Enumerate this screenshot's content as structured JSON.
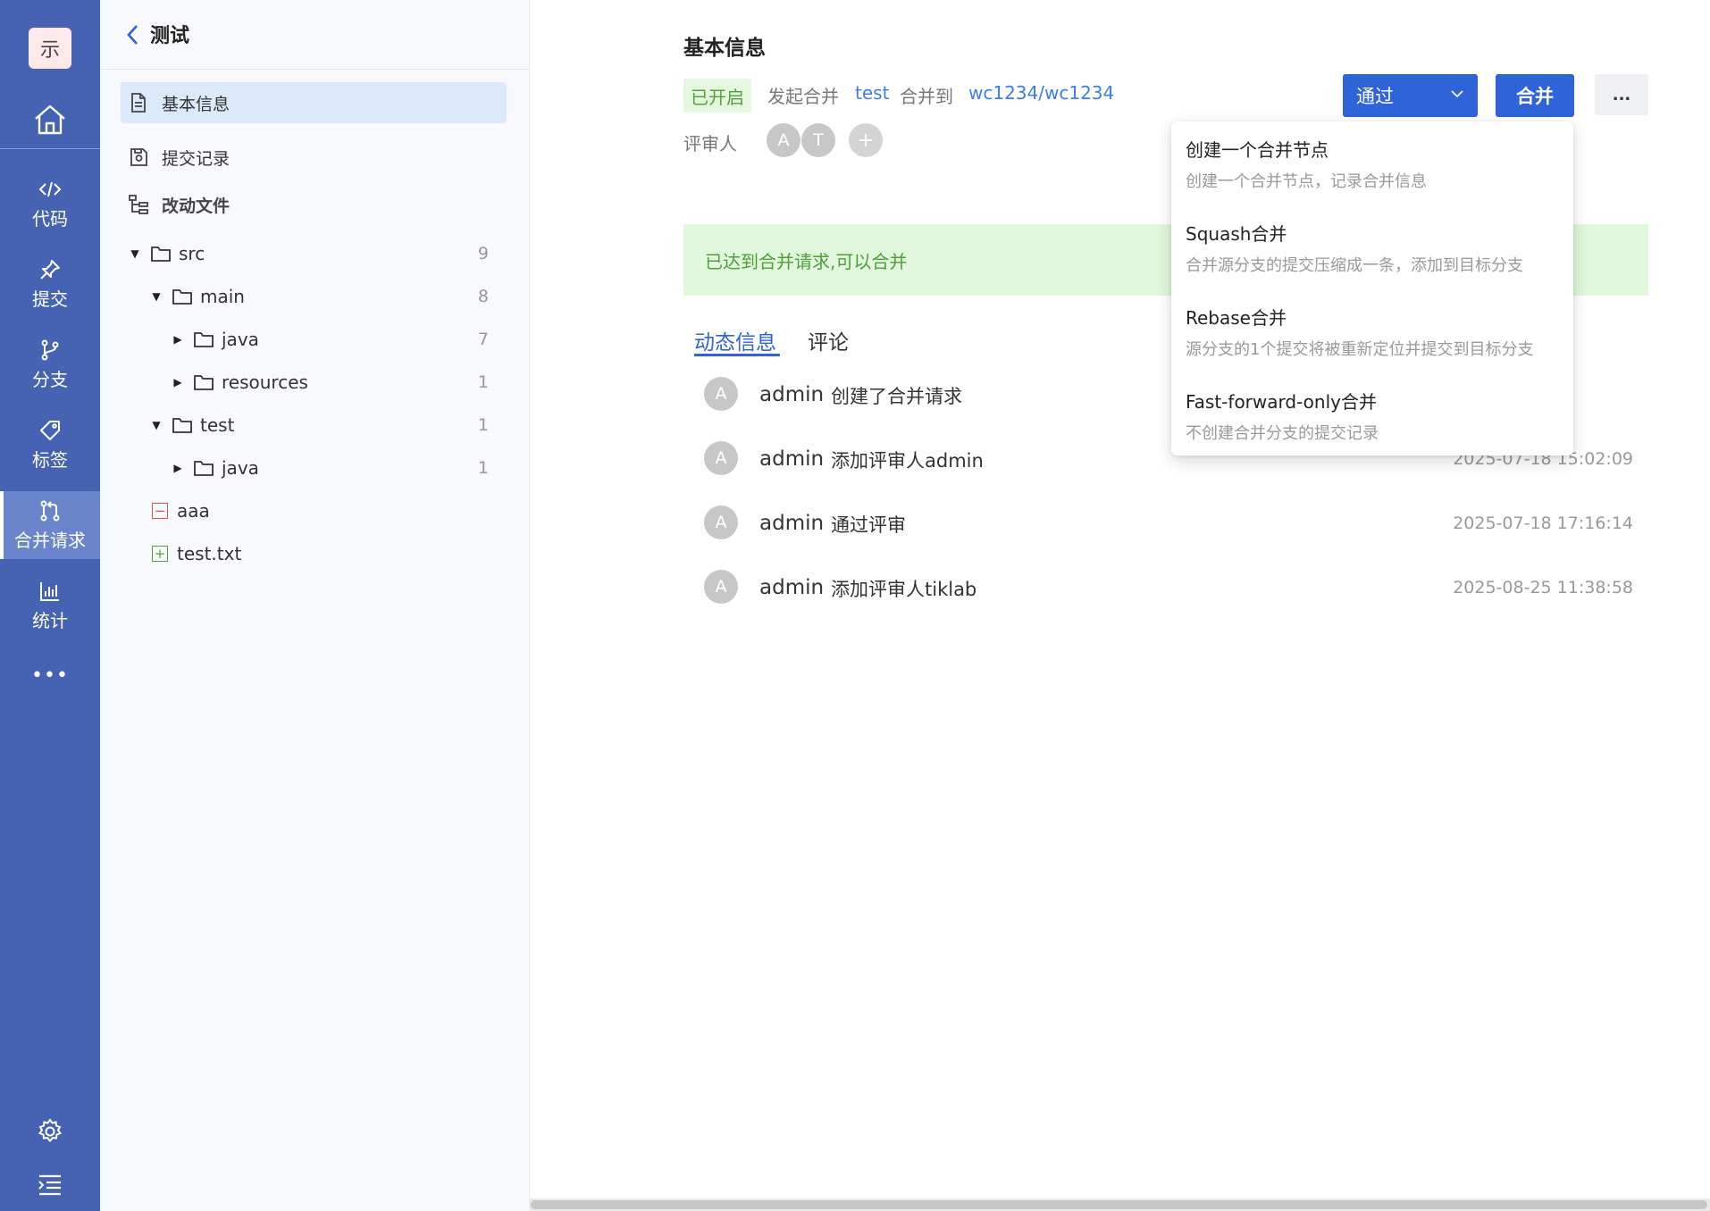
{
  "rail": {
    "logo_char": "示",
    "items": [
      {
        "label": "代码",
        "icon": "code-icon"
      },
      {
        "label": "提交",
        "icon": "pin-icon"
      },
      {
        "label": "分支",
        "icon": "branch-icon"
      },
      {
        "label": "标签",
        "icon": "tag-icon"
      },
      {
        "label": "合并请求",
        "icon": "merge-request-icon",
        "active": true
      },
      {
        "label": "统计",
        "icon": "bar-chart-icon"
      }
    ],
    "more": "•••"
  },
  "panel": {
    "title": "测试",
    "menu": [
      {
        "label": "基本信息",
        "active": true
      },
      {
        "label": "提交记录"
      },
      {
        "label": "改动文件"
      }
    ],
    "tree": [
      {
        "name": "src",
        "count": "9"
      },
      {
        "name": "main",
        "count": "8"
      },
      {
        "name": "java",
        "count": "7"
      },
      {
        "name": "resources",
        "count": "1"
      },
      {
        "name": "test",
        "count": "1"
      },
      {
        "name": "java",
        "count": "1"
      }
    ],
    "files": [
      {
        "name": "aaa",
        "mark": "−",
        "status": "deleted",
        "color": "#d9534f"
      },
      {
        "name": "test.txt",
        "mark": "+",
        "status": "added",
        "color": "#52a13b"
      }
    ]
  },
  "main": {
    "title": "基本信息",
    "status": "已开启",
    "initiator_label": "发起合并",
    "source_branch": "test",
    "target_label": "合并到",
    "target_branch": "wc1234/wc1234",
    "reviewer_label": "评审人",
    "reviewers": [
      "A",
      "T"
    ],
    "add_reviewer": "+",
    "approve_button": "通过",
    "merge_button": "合并",
    "more_button": "...",
    "banner": "已达到合并请求,可以合并",
    "tabs": [
      {
        "label": "动态信息",
        "active": true
      },
      {
        "label": "评论"
      }
    ],
    "activities": [
      {
        "avatar": "A",
        "user": "admin",
        "text": "创建了合并请求",
        "time": ""
      },
      {
        "avatar": "A",
        "user": "admin",
        "text": "添加评审人admin",
        "time": "2025-07-18 15:02:09"
      },
      {
        "avatar": "A",
        "user": "admin",
        "text": "通过评审",
        "time": "2025-07-18 17:16:14"
      },
      {
        "avatar": "A",
        "user": "admin",
        "text": "添加评审人tiklab",
        "time": "2025-08-25 11:38:58"
      }
    ]
  },
  "dropdown": {
    "items": [
      {
        "title": "创建一个合并节点",
        "desc": "创建一个合并节点，记录合并信息"
      },
      {
        "title": "Squash合并",
        "desc": "合并源分支的提交压缩成一条，添加到目标分支"
      },
      {
        "title": "Rebase合并",
        "desc": "源分支的1个提交将被重新定位并提交到目标分支"
      },
      {
        "title": "Fast-forward-only合并",
        "desc": "不创建合并分支的提交记录"
      }
    ]
  },
  "colors": {
    "rail": "#4562b3",
    "accent": "#2f63d8",
    "link": "#3d7ee8",
    "success_bg": "#e1f8dc",
    "success_text": "#4f9e3a"
  }
}
